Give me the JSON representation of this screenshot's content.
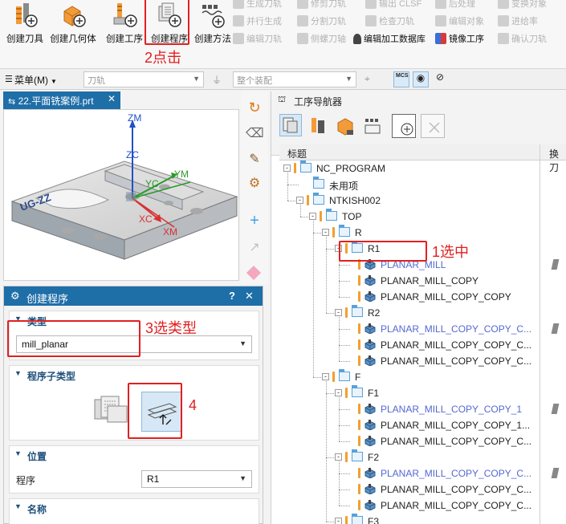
{
  "ribbon": {
    "big_buttons": [
      {
        "label": "创建刀具",
        "icon": "create-tool-icon"
      },
      {
        "label": "创建几何体",
        "icon": "create-geometry-icon"
      },
      {
        "label": "创建工序",
        "icon": "create-operation-icon"
      },
      {
        "label": "创建程序",
        "icon": "create-program-icon"
      },
      {
        "label": "创建方法",
        "icon": "create-method-icon"
      }
    ],
    "small_buttons": [
      {
        "label": "生成刀轨",
        "enabled": false
      },
      {
        "label": "修剪刀轨",
        "enabled": false
      },
      {
        "label": "输出 CLSF",
        "enabled": false
      },
      {
        "label": "后处理",
        "enabled": false
      },
      {
        "label": "变换对象",
        "enabled": false
      },
      {
        "label": "并行生成",
        "enabled": false
      },
      {
        "label": "分割刀轨",
        "enabled": false
      },
      {
        "label": "检查刀轨",
        "enabled": false
      },
      {
        "label": "编辑对象",
        "enabled": false
      },
      {
        "label": "进给率",
        "enabled": false
      },
      {
        "label": "编辑刀轨",
        "enabled": false
      },
      {
        "label": "侧螺刀轴",
        "enabled": false
      },
      {
        "label": "编辑加工数据库",
        "enabled": true
      },
      {
        "label": "镜像工序",
        "enabled": true
      },
      {
        "label": "确认刀轨",
        "enabled": false
      }
    ]
  },
  "toolbar2": {
    "menu_label": "菜单(M)",
    "combo1_value": "刀轨",
    "combo2_value": "整个装配"
  },
  "viewport": {
    "tab_title": "22.平面铣案例.prt",
    "axes": {
      "zm": "ZM",
      "zc": "ZC",
      "yc": "YC",
      "ym": "YM",
      "xc": "XC",
      "xm": "XM"
    },
    "part_text": "UG-ZZ"
  },
  "dialog": {
    "title": "创建程序",
    "sections": {
      "type": "类型",
      "subtype": "程序子类型",
      "location": "位置",
      "name": "名称"
    },
    "type_value": "mill_planar",
    "program_label": "程序",
    "program_value": "R1"
  },
  "navigator": {
    "title": "工序导航器",
    "col_title": "标题",
    "col_tool": "换刀",
    "rows": [
      {
        "text": "NC_PROGRAM",
        "level": 0,
        "kind": "root",
        "toggle": "-",
        "blue": false
      },
      {
        "text": "未用项",
        "level": 1,
        "kind": "folder",
        "toggle": "",
        "blue": false
      },
      {
        "text": "NTKISH002",
        "level": 1,
        "kind": "program",
        "toggle": "-",
        "blue": false
      },
      {
        "text": "TOP",
        "level": 2,
        "kind": "program",
        "toggle": "-",
        "blue": false
      },
      {
        "text": "R",
        "level": 3,
        "kind": "program",
        "toggle": "-",
        "blue": false
      },
      {
        "text": "R1",
        "level": 4,
        "kind": "program",
        "toggle": "-",
        "blue": false
      },
      {
        "text": "PLANAR_MILL",
        "level": 5,
        "kind": "op",
        "toggle": "",
        "blue": true,
        "tool_mark": true
      },
      {
        "text": "PLANAR_MILL_COPY",
        "level": 5,
        "kind": "op",
        "toggle": "",
        "blue": false
      },
      {
        "text": "PLANAR_MILL_COPY_COPY",
        "level": 5,
        "kind": "op",
        "toggle": "",
        "blue": false
      },
      {
        "text": "R2",
        "level": 4,
        "kind": "program",
        "toggle": "-",
        "blue": false
      },
      {
        "text": "PLANAR_MILL_COPY_COPY_C...",
        "level": 5,
        "kind": "op",
        "toggle": "",
        "blue": true,
        "tool_mark": true
      },
      {
        "text": "PLANAR_MILL_COPY_COPY_C...",
        "level": 5,
        "kind": "op",
        "toggle": "",
        "blue": false
      },
      {
        "text": "PLANAR_MILL_COPY_COPY_C...",
        "level": 5,
        "kind": "op",
        "toggle": "",
        "blue": false
      },
      {
        "text": "F",
        "level": 3,
        "kind": "program",
        "toggle": "-",
        "blue": false
      },
      {
        "text": "F1",
        "level": 4,
        "kind": "program",
        "toggle": "-",
        "blue": false
      },
      {
        "text": "PLANAR_MILL_COPY_COPY_1",
        "level": 5,
        "kind": "op",
        "toggle": "",
        "blue": true,
        "tool_mark": true
      },
      {
        "text": "PLANAR_MILL_COPY_COPY_1...",
        "level": 5,
        "kind": "op",
        "toggle": "",
        "blue": false
      },
      {
        "text": "PLANAR_MILL_COPY_COPY_C...",
        "level": 5,
        "kind": "op",
        "toggle": "",
        "blue": false
      },
      {
        "text": "F2",
        "level": 4,
        "kind": "program",
        "toggle": "-",
        "blue": false
      },
      {
        "text": "PLANAR_MILL_COPY_COPY_C...",
        "level": 5,
        "kind": "op",
        "toggle": "",
        "blue": true,
        "tool_mark": true
      },
      {
        "text": "PLANAR_MILL_COPY_COPY_C...",
        "level": 5,
        "kind": "op",
        "toggle": "",
        "blue": false
      },
      {
        "text": "PLANAR_MILL_COPY_COPY_C...",
        "level": 5,
        "kind": "op",
        "toggle": "",
        "blue": false
      },
      {
        "text": "F3",
        "level": 4,
        "kind": "program",
        "toggle": "-",
        "blue": false
      }
    ]
  },
  "annotations": {
    "step1": "1选中",
    "step2": "2点击",
    "step3": "3选类型",
    "step4": "4"
  },
  "colors": {
    "accent": "#1e6ea8",
    "annotation_red": "#e02020",
    "highlight_blue": "#5468d4"
  }
}
